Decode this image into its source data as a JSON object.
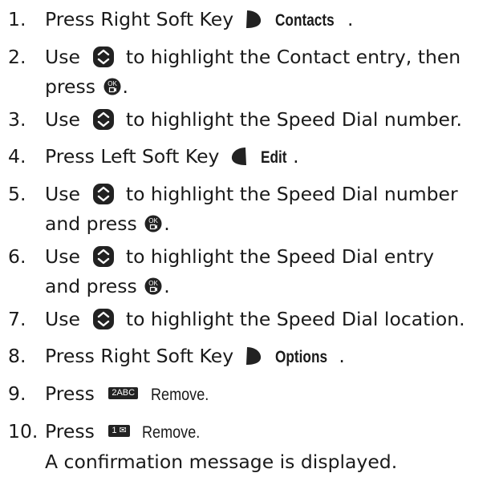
{
  "steps": [
    {
      "num": "1.",
      "parts": [
        "Press Right Soft Key",
        "Contacts",
        "."
      ]
    },
    {
      "num": "2.",
      "parts": [
        "Use",
        "to highlight the Contact entry, then",
        "press",
        "."
      ]
    },
    {
      "num": "3.",
      "parts": [
        "Use",
        "to highlight the Speed Dial number."
      ]
    },
    {
      "num": "4.",
      "parts": [
        "Press Left Soft Key",
        "Edit",
        "."
      ]
    },
    {
      "num": "5.",
      "parts": [
        "Use",
        "to highlight the Speed Dial number",
        "and press",
        "."
      ]
    },
    {
      "num": "6.",
      "parts": [
        "Use",
        "to highlight the Speed Dial entry",
        "and press",
        "."
      ]
    },
    {
      "num": "7.",
      "parts": [
        "Use",
        "to highlight the Speed Dial location."
      ]
    },
    {
      "num": "8.",
      "parts": [
        "Press Right Soft Key",
        "Options",
        "."
      ]
    },
    {
      "num": "9.",
      "parts": [
        "Press",
        "2ABC",
        "Remove."
      ]
    },
    {
      "num": "10.",
      "parts": [
        "Press",
        "1",
        "Remove.",
        "A confirmation message is displayed."
      ]
    }
  ],
  "icons": {
    "nav_key": "nav-up-down-icon",
    "ok_key": "ok-key-icon",
    "right_soft_key": "right-soft-key-icon",
    "left_soft_key": "left-soft-key-icon",
    "mail_glyph": "envelope-icon"
  },
  "colors": {
    "text": "#1a1a1a",
    "icon": "#222222"
  }
}
